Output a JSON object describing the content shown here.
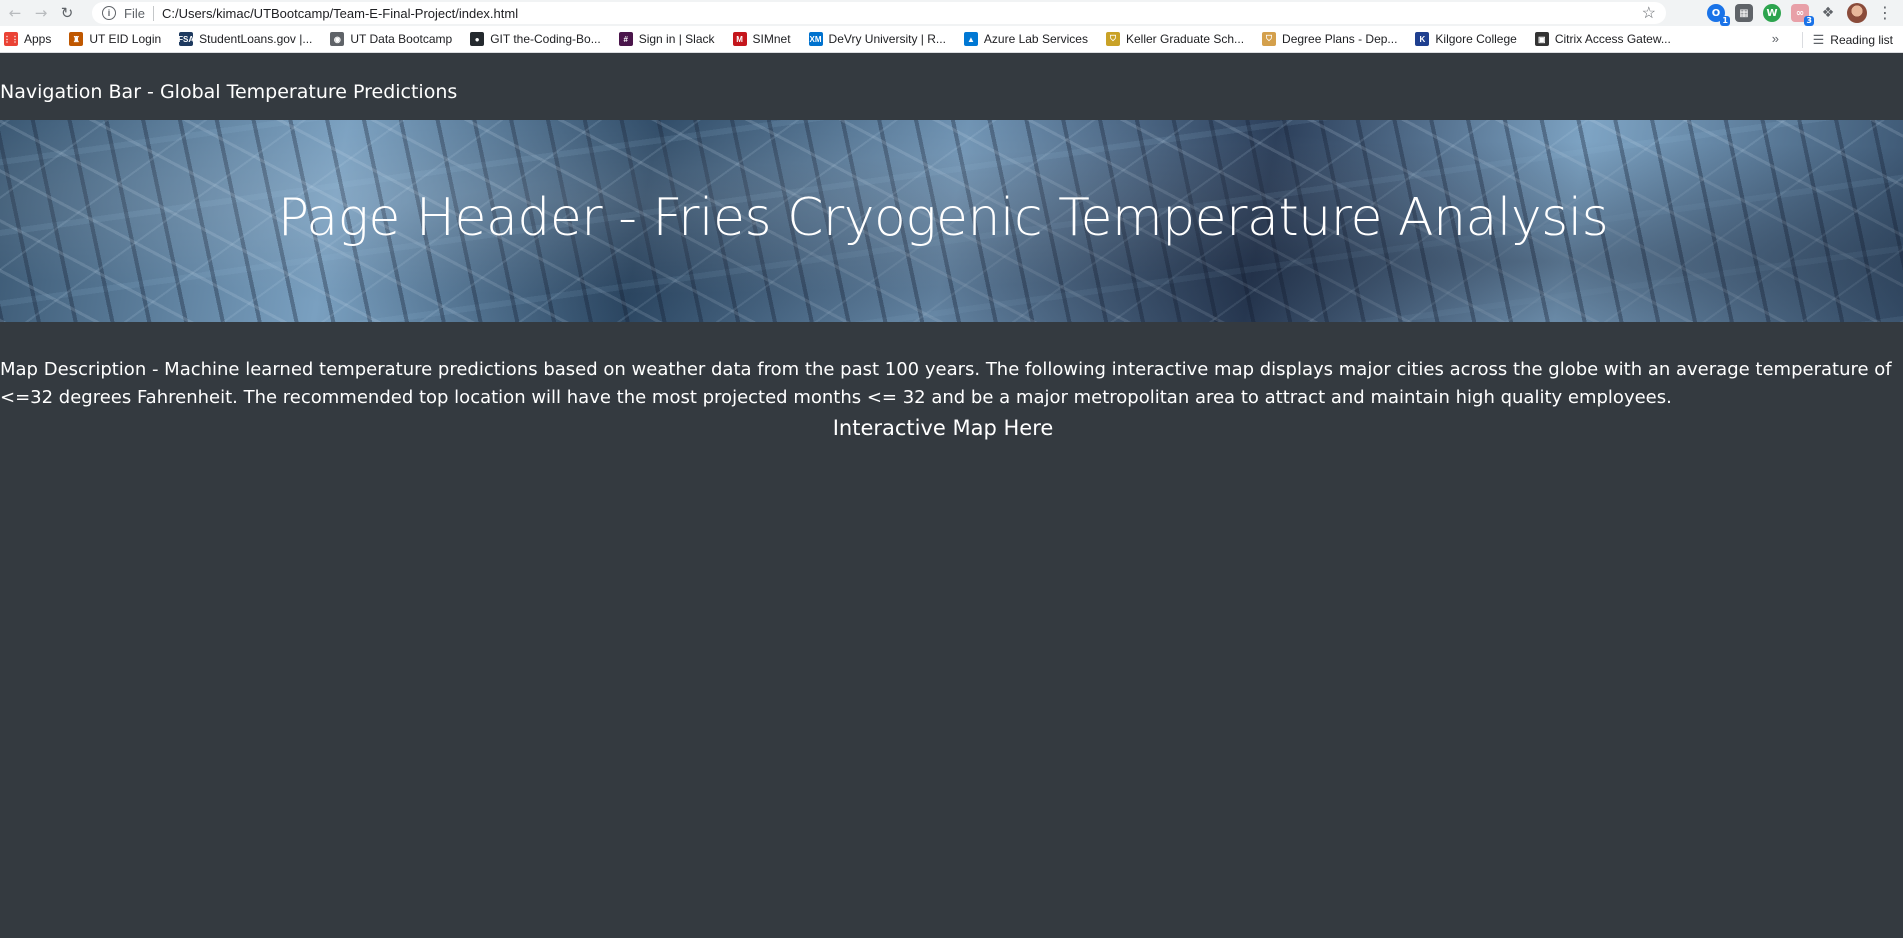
{
  "browser": {
    "scheme_label": "File",
    "url": "C:/Users/kimac/UTBootcamp/Team-E-Final-Project/index.html",
    "extension_badges": [
      "1",
      "3"
    ]
  },
  "bookmarks": [
    {
      "label": "Apps",
      "icon": "apps-grid-icon",
      "color": "#ea4335"
    },
    {
      "label": "UT EID Login",
      "icon": "ut-tower-icon",
      "color": "#bf5700"
    },
    {
      "label": "StudentLoans.gov |...",
      "icon": "fsa-icon",
      "color": "#1e3a5f"
    },
    {
      "label": "UT Data Bootcamp",
      "icon": "globe-icon",
      "color": "#5f6368"
    },
    {
      "label": "GIT the-Coding-Bo...",
      "icon": "github-icon",
      "color": "#24292e"
    },
    {
      "label": "Sign in | Slack",
      "icon": "slack-icon",
      "color": "#4a154b"
    },
    {
      "label": "SIMnet",
      "icon": "simnet-icon",
      "color": "#c4161c"
    },
    {
      "label": "DeVry University | R...",
      "icon": "xm-icon",
      "color": "#0072ce"
    },
    {
      "label": "Azure Lab Services",
      "icon": "azure-icon",
      "color": "#0078d4"
    },
    {
      "label": "Keller Graduate Sch...",
      "icon": "shield-icon",
      "color": "#c9a227"
    },
    {
      "label": "Degree Plans - Dep...",
      "icon": "shield-icon",
      "color": "#d4a04c"
    },
    {
      "label": "Kilgore College",
      "icon": "kc-icon",
      "color": "#1f3f8f"
    },
    {
      "label": "Citrix Access Gatew...",
      "icon": "citrix-icon",
      "color": "#333333"
    }
  ],
  "bookmarks_more": "»",
  "reading_list": "Reading list",
  "navbar": {
    "brand": "Navigation Bar - Global Temperature Predictions"
  },
  "header": {
    "title": "Page Header - Fries Cryogenic Temperature Analysis"
  },
  "main": {
    "map_description": "Map Description - Machine learned temperature predictions based on weather data from the past 100 years. The following interactive map displays major cities across the globe with an average temperature of <=32 degrees Fahrenheit. The recommended top location will have the most projected months <= 32 and be a major metropolitan area to attract and maintain high quality employees.",
    "map_placeholder": "Interactive Map Here"
  }
}
